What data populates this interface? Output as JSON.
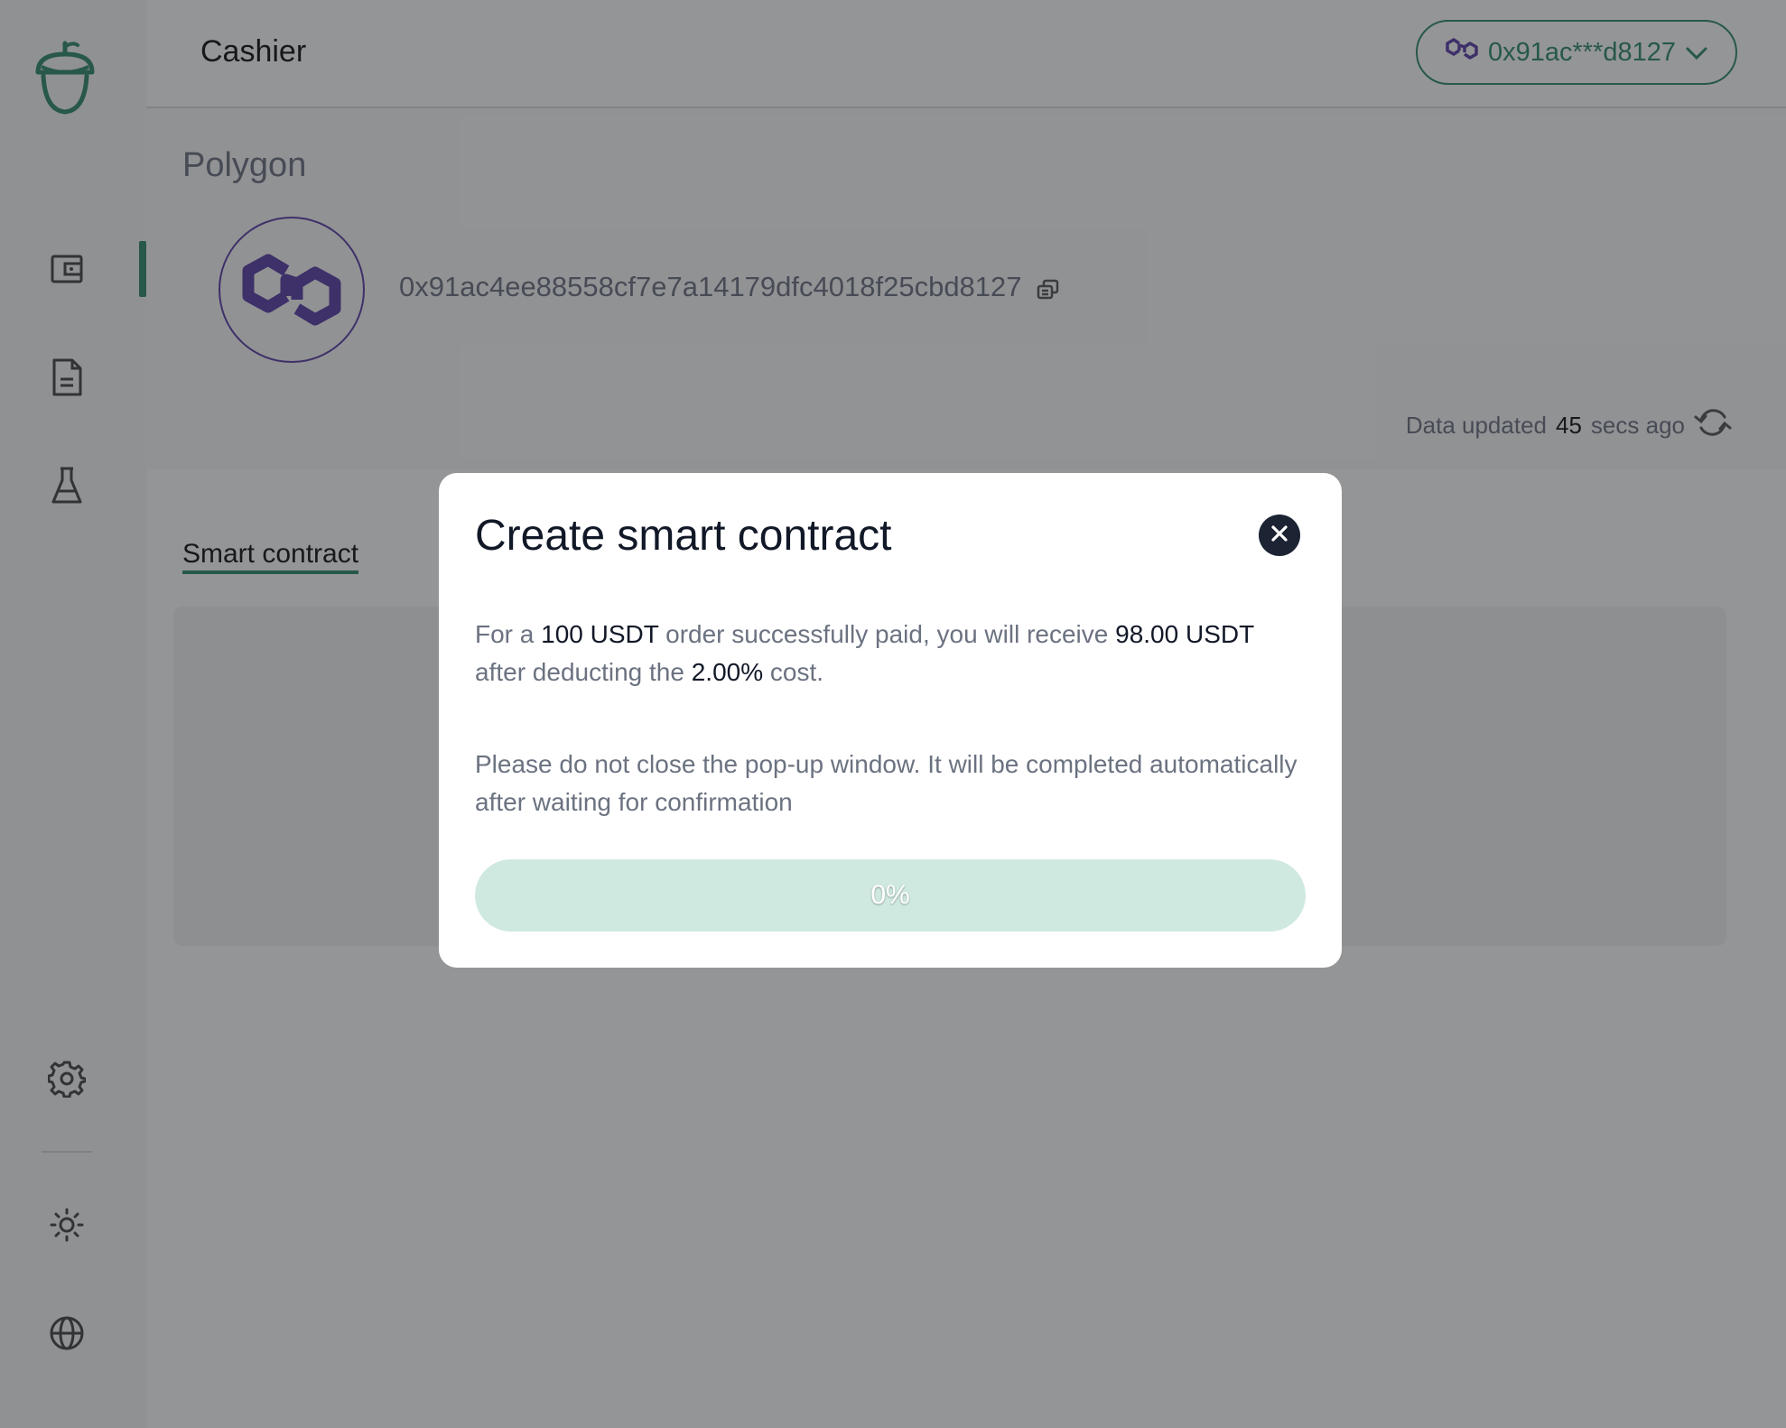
{
  "header": {
    "title": "Cashier",
    "wallet_label": "0x91ac***d8127"
  },
  "network": {
    "name": "Polygon",
    "address": "0x91ac4ee88558cf7e7a14179dfc4018f25cbd8127",
    "updated_prefix": "Data updated",
    "updated_value": "45",
    "updated_suffix": "secs ago"
  },
  "tabs": [
    {
      "label": "Smart contract"
    }
  ],
  "modal": {
    "title": "Create smart contract",
    "p1": {
      "a": "For a ",
      "b": "100 USDT",
      "c": " order successfully paid, you will receive ",
      "d": "98.00 USDT",
      "e": " after deducting the ",
      "f": "2.00%",
      "g": " cost."
    },
    "p2": "Please do not close the pop-up window. It will be completed automatically after waiting for confirmation",
    "progress_label": "0%",
    "progress_fraction": 0
  },
  "colors": {
    "accent": "#2f8a6c",
    "polygon": "#5b3fa8",
    "progress_track": "#cfe9e1"
  },
  "icons": {
    "logo": "acorn-logo",
    "nav": [
      "wallet-icon",
      "document-icon",
      "flask-icon",
      "gear-icon",
      "sun-icon",
      "globe-icon"
    ]
  }
}
